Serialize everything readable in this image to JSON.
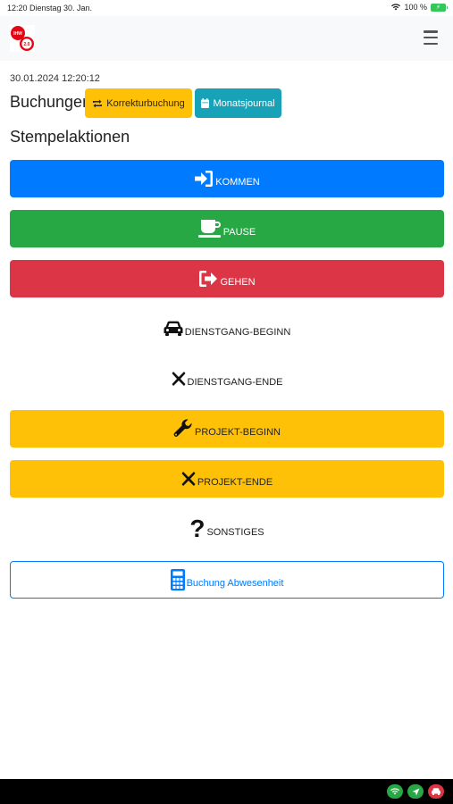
{
  "status_bar": {
    "time": "12:20",
    "date": "Dienstag 30. Jan.",
    "battery": "100 %"
  },
  "header": {
    "logo_top": "IHW",
    "logo_bottom": "2.0"
  },
  "timestamp": "30.01.2024 12:20:12",
  "buchungen": {
    "title": "Buchungen",
    "korrektur_label": "Korrekturbuchung",
    "monatsjournal_label": "Monatsjournal"
  },
  "stempel": {
    "title": "Stempelaktionen",
    "actions": [
      {
        "label": "KOMMEN",
        "icon": "sign-in-icon",
        "color": "#007bff"
      },
      {
        "label": "PAUSE",
        "icon": "coffee-icon",
        "color": "#28a745"
      },
      {
        "label": "GEHEN",
        "icon": "sign-out-icon",
        "color": "#dc3545"
      },
      {
        "label": "DIENSTGANG-BEGINN",
        "icon": "car-icon",
        "color": "transparent"
      },
      {
        "label": "DIENSTGANG-ENDE",
        "icon": "x-icon",
        "color": "transparent"
      },
      {
        "label": "PROJEKT-BEGINN",
        "icon": "wrench-icon",
        "color": "#ffc107"
      },
      {
        "label": "PROJEKT-ENDE",
        "icon": "x-icon",
        "color": "#ffc107"
      },
      {
        "label": "SONSTIGES",
        "icon": "question-icon",
        "color": "transparent"
      }
    ],
    "absence_label": "Buchung Abwesenheit"
  }
}
